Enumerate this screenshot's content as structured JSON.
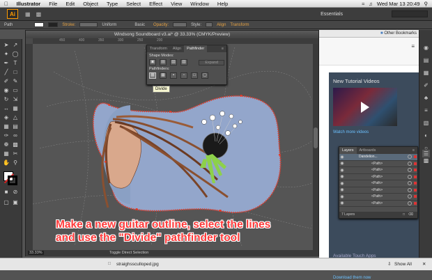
{
  "menubar": {
    "app_name": "Illustrator",
    "items": [
      "File",
      "Edit",
      "Object",
      "Type",
      "Select",
      "Effect",
      "View",
      "Window",
      "Help"
    ],
    "clock": "Wed Mar 13  20:49"
  },
  "appbar": {
    "logo": "Ai",
    "workspace": "Essentials"
  },
  "control_bar": {
    "selection_type": "Path",
    "stroke_label": "Stroke:",
    "profile": "Uniform",
    "brush": "Basic",
    "opacity_label": "Opacity:",
    "style_label": "Style:",
    "align_label": "Align",
    "transform_label": "Transform"
  },
  "document": {
    "title": "Windsong Soundboard v3.ai* @ 33.33% (CMYK/Preview)",
    "ruler_marks": [
      "450",
      "400",
      "350",
      "300",
      "250",
      "200",
      "150",
      "100",
      "50",
      "0",
      "50",
      "100",
      "150",
      "200"
    ],
    "zoom": "33.33%",
    "status_tool": "Toggle Direct Selection"
  },
  "pathfinder_panel": {
    "tabs": [
      "Transform",
      "Align",
      "Pathfinder"
    ],
    "shape_modes_label": "Shape Modes:",
    "expand_label": "Expand",
    "pathfinders_label": "Pathfinders:",
    "tooltip": "Divide"
  },
  "browser": {
    "bookmarks": "Other Bookmarks",
    "tutorial_title": "New Tutorial Videos",
    "watch_more": "Watch more videos",
    "touch_apps": "Available Touch Apps",
    "download": "Download them now"
  },
  "layers_panel": {
    "tabs": [
      "Layers",
      "Artboards"
    ],
    "top_layer": "Dandelion...",
    "paths": [
      "<Path>",
      "<Path>",
      "<Path>",
      "<Path>",
      "<Path>",
      "<Path>",
      "<Path>"
    ],
    "footer": "7 Layers"
  },
  "caption": {
    "line1": "Make a new guitar outline, select the lines",
    "line2": "and use the \"Divide\" pathfinder tool"
  },
  "download_bar": {
    "file": "straighssculloped.jpg",
    "show_all": "Show All"
  }
}
